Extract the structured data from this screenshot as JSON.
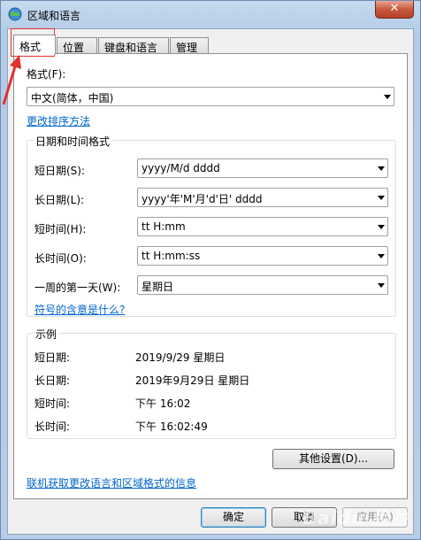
{
  "window": {
    "title": "区域和语言",
    "close_glyph": "✕"
  },
  "tabs": [
    {
      "label": "格式",
      "active": true
    },
    {
      "label": "位置",
      "active": false
    },
    {
      "label": "键盘和语言",
      "active": false
    },
    {
      "label": "管理",
      "active": false
    }
  ],
  "format": {
    "label": "格式(F):",
    "value": "中文(简体，中国)",
    "sort_link": "更改排序方法"
  },
  "datetime": {
    "group_title": "日期和时间格式",
    "rows": [
      {
        "label": "短日期(S):",
        "value": "yyyy/M/d dddd"
      },
      {
        "label": "长日期(L):",
        "value": "yyyy'年'M'月'd'日' dddd"
      },
      {
        "label": "短时间(H):",
        "value": "tt H:mm"
      },
      {
        "label": "长时间(O):",
        "value": "tt H:mm:ss"
      },
      {
        "label": "一周的第一天(W):",
        "value": "星期日"
      }
    ],
    "meaning_link": "符号的含意是什么?"
  },
  "examples": {
    "group_title": "示例",
    "rows": [
      {
        "label": "短日期:",
        "value": "2019/9/29 星期日"
      },
      {
        "label": "长日期:",
        "value": "2019年9月29日 星期日"
      },
      {
        "label": "短时间:",
        "value": "下午 16:02"
      },
      {
        "label": "长时间:",
        "value": "下午 16:02:49"
      }
    ]
  },
  "other_settings_label": "其他设置(D)...",
  "online_link": "联机获取更改语言和区域格式的信息",
  "footer": {
    "ok_label": "确定",
    "cancel_label": "取消",
    "apply_label": "应用(A)"
  },
  "watermark": "Baidu 经验",
  "colors": {
    "link": "#0066cc",
    "annotation": "#e03030",
    "close": "#c75a3e"
  }
}
